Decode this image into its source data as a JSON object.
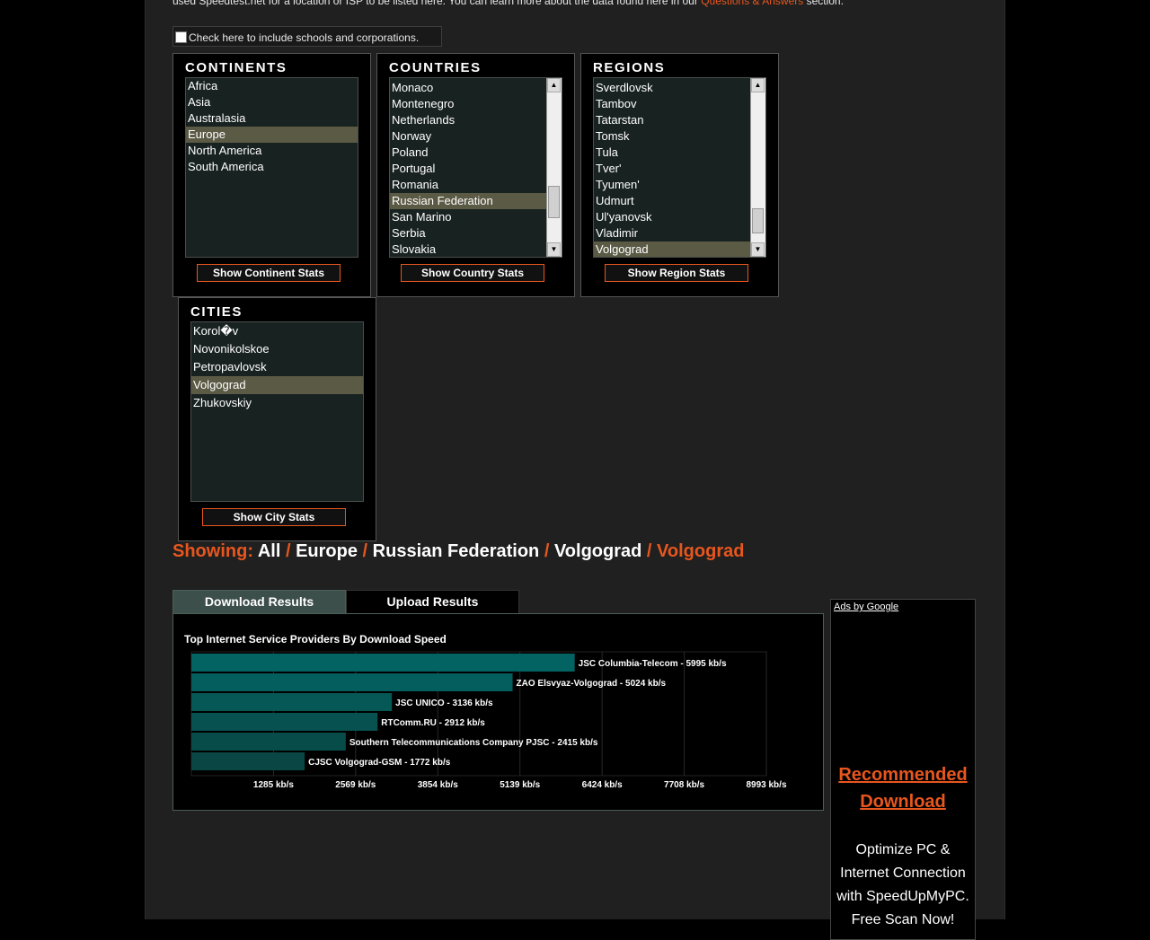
{
  "intro": {
    "text_before": "used Speedtest.net for a location or ISP to be listed here. You can learn more about the data found here in our ",
    "link": "Questions & Answers",
    "text_after": " section."
  },
  "include_checkbox": {
    "label": "Check here to include schools and corporations.",
    "checked": false
  },
  "continents": {
    "title": "CONTINENTS",
    "items": [
      "Africa",
      "Asia",
      "Australasia",
      "Europe",
      "North America",
      "South America"
    ],
    "selected": "Europe",
    "button": "Show Continent Stats"
  },
  "countries": {
    "title": "COUNTRIES",
    "items": [
      "Monaco",
      "Montenegro",
      "Netherlands",
      "Norway",
      "Poland",
      "Portugal",
      "Romania",
      "Russian Federation",
      "San Marino",
      "Serbia",
      "Slovakia"
    ],
    "selected": "Russian Federation",
    "button": "Show Country Stats"
  },
  "regions": {
    "title": "REGIONS",
    "items": [
      "Sverdlovsk",
      "Tambov",
      "Tatarstan",
      "Tomsk",
      "Tula",
      "Tver'",
      "Tyumen'",
      "Udmurt",
      "Ul'yanovsk",
      "Vladimir",
      "Volgograd"
    ],
    "selected": "Volgograd",
    "button": "Show Region Stats"
  },
  "cities": {
    "title": "CITIES",
    "items": [
      "Korol�v",
      "Novonikolskoe",
      "Petropavlovsk",
      "Volgograd",
      "Zhukovskiy"
    ],
    "selected": "Volgograd",
    "button": "Show City Stats"
  },
  "showing": {
    "label": "Showing:",
    "separator": "/",
    "path": [
      "All",
      "Europe",
      "Russian Federation",
      "Volgograd"
    ],
    "current": "Volgograd"
  },
  "tabs": {
    "download": "Download Results",
    "upload": "Upload Results",
    "active": "download"
  },
  "chart_data": {
    "type": "bar",
    "orientation": "horizontal",
    "title": "Top Internet Service Providers By Download Speed",
    "categories": [
      "JSC Columbia-Telecom",
      "ZAO Elsvyaz-Volgograd",
      "JSC UNICO",
      "RTComm.RU",
      "Southern Telecommunications Company PJSC",
      "CJSC Volgograd-GSM"
    ],
    "values": [
      5995,
      5024,
      3136,
      2912,
      2415,
      1772
    ],
    "data_labels": [
      "JSC Columbia-Telecom - 5995 kb/s",
      "ZAO Elsvyaz-Volgograd - 5024 kb/s",
      "JSC UNICO - 3136 kb/s",
      "RTComm.RU - 2912 kb/s",
      "Southern Telecommunications Company PJSC - 2415 kb/s",
      "CJSC Volgograd-GSM - 1772 kb/s"
    ],
    "xticks": [
      1285,
      2569,
      3854,
      5139,
      6424,
      7708,
      8993
    ],
    "xtick_labels": [
      "1285 kb/s",
      "2569 kb/s",
      "3854 kb/s",
      "5139 kb/s",
      "6424 kb/s",
      "7708 kb/s",
      "8993 kb/s"
    ],
    "xlim": [
      0,
      8993
    ],
    "grid": true,
    "colors": [
      "#036363",
      "#055e5e",
      "#065856",
      "#075250",
      "#084c4a",
      "#094644"
    ]
  },
  "ad": {
    "ads_by": "Ads by Google",
    "headline_1": "Recommended",
    "headline_2": "Download",
    "line_1": "Optimize PC &",
    "line_2": "Internet Connection",
    "line_3": "with SpeedUpMyPC.",
    "line_4": "Free Scan Now!"
  }
}
